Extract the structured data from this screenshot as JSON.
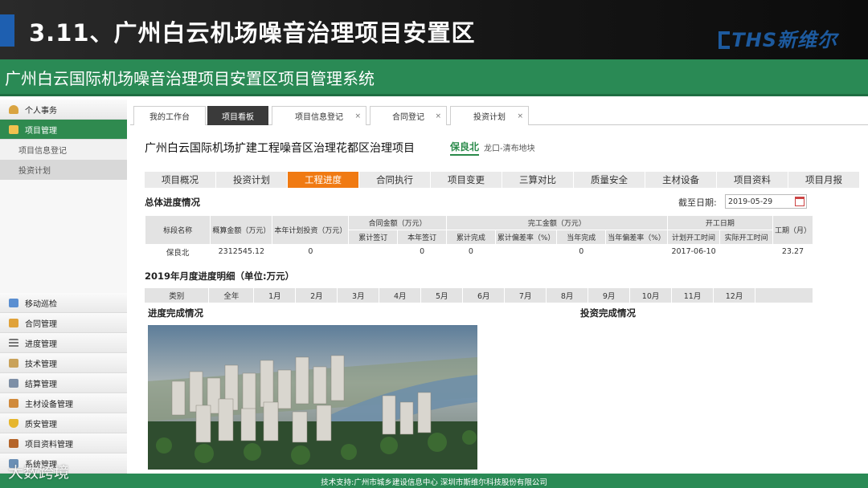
{
  "slide": {
    "title": "3.11、广州白云机场噪音治理项目安置区",
    "logo": "THS新维尔"
  },
  "system": {
    "title": "广州白云国际机场噪音治理项目安置区项目管理系统"
  },
  "sidebar": {
    "top_items": [
      {
        "label": "个人事务",
        "icon": "person-icon"
      },
      {
        "label": "项目管理",
        "icon": "folder-icon",
        "active": true
      }
    ],
    "sub_items": [
      {
        "label": "项目信息登记"
      },
      {
        "label": "投资计划"
      }
    ],
    "bottom_items": [
      {
        "label": "移动巡检",
        "icon": "monitor-icon"
      },
      {
        "label": "合同管理",
        "icon": "contract-icon"
      },
      {
        "label": "进度管理",
        "icon": "list-icon"
      },
      {
        "label": "技术管理",
        "icon": "edit-icon"
      },
      {
        "label": "结算管理",
        "icon": "calculator-icon"
      },
      {
        "label": "主材设备管理",
        "icon": "box-icon"
      },
      {
        "label": "质安管理",
        "icon": "shield-icon"
      },
      {
        "label": "项目资料管理",
        "icon": "archive-icon"
      },
      {
        "label": "系统管理",
        "icon": "gear-icon"
      }
    ]
  },
  "top_tabs": [
    {
      "label": "我的工作台",
      "closable": false
    },
    {
      "label": "项目看板",
      "closable": false,
      "active": true
    },
    {
      "label": "项目信息登记",
      "closable": true
    },
    {
      "label": "合同登记",
      "closable": true
    },
    {
      "label": "投资计划",
      "closable": true
    }
  ],
  "project": {
    "name": "广州白云国际机场扩建工程噪音区治理花都区治理项目",
    "tag": "保良北",
    "location": "龙口-清布地块"
  },
  "nav_tabs": [
    {
      "label": "项目概况"
    },
    {
      "label": "投资计划"
    },
    {
      "label": "工程进度",
      "active": true
    },
    {
      "label": "合同执行"
    },
    {
      "label": "项目变更"
    },
    {
      "label": "三算对比"
    },
    {
      "label": "质量安全"
    },
    {
      "label": "主材设备"
    },
    {
      "label": "项目资料"
    },
    {
      "label": "项目月报"
    }
  ],
  "overall": {
    "title": "总体进度情况",
    "date_label": "截至日期:",
    "date_value": "2019-05-29",
    "headers": {
      "section_name": "标段名称",
      "budget": "概算金额（万元）",
      "annual_plan": "本年计划投资（万元）",
      "contract_group": "合同金额（万元）",
      "contract_total": "累计签订",
      "contract_year": "本年签订",
      "completed_group": "完工金额（万元）",
      "completed_total": "累计完成",
      "completed_deviation": "累计偏差率（%）",
      "completed_year": "当年完成",
      "completed_year_deviation": "当年偏差率（%）",
      "start_group": "开工日期",
      "planned_start": "计划开工时间",
      "actual_start": "实际开工时间",
      "duration": "工期（月）"
    },
    "row": {
      "section_name": "保良北",
      "budget": "2312545.12",
      "annual_plan": "0",
      "contract_total": "",
      "contract_year": "0",
      "completed_total": "0",
      "completed_deviation": "",
      "completed_year": "0",
      "completed_year_deviation": "",
      "planned_start": "2017-06-10",
      "actual_start": "",
      "duration": "23.27"
    }
  },
  "monthly": {
    "title": "2019年月度进度明细（单位:万元）",
    "columns": [
      "类别",
      "全年",
      "1月",
      "2月",
      "3月",
      "4月",
      "5月",
      "6月",
      "7月",
      "8月",
      "9月",
      "10月",
      "11月",
      "12月",
      ""
    ]
  },
  "progress_title": "进度完成情况",
  "investment_title": "投资完成情况",
  "footer": {
    "text": "技术支持:广州市城乡建设信息中心 深圳市斯维尔科技股份有限公司"
  },
  "watermark": "大数跨境"
}
